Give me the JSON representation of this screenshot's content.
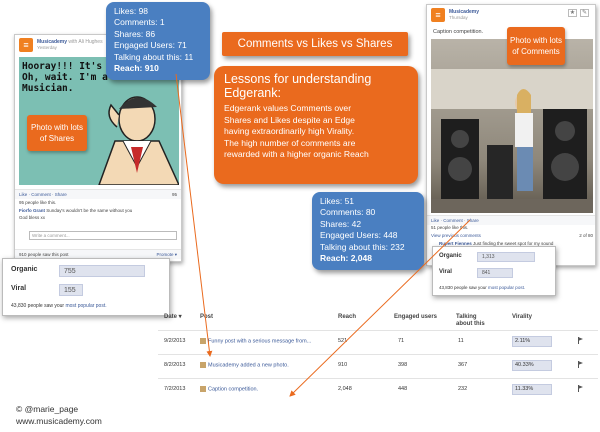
{
  "title_banner": "Comments vs Likes vs Shares",
  "lessons": {
    "heading_line1": "Lessons for understanding",
    "heading_line2": "Edgerank:",
    "body_lines": [
      "Edgerank values Comments over",
      "Shares  and Likes despite an Edge",
      "having extraordinarily  high Virality.",
      "The high number of comments are",
      "rewarded with a higher organic Reach"
    ]
  },
  "stats_left": {
    "lines": [
      "Likes: 98",
      "Comments: 1",
      "Shares: 86",
      "Engaged Users: 71",
      "Talking about this: 11"
    ],
    "reach": "Reach: 910"
  },
  "stats_right": {
    "lines": [
      "Likes: 51",
      "Comments: 80",
      "Shares: 42",
      "Engaged Users: 448",
      "Talking about this: 232"
    ],
    "reach": "Reach: 2,048"
  },
  "left_post": {
    "page_name": "Musicademy",
    "with_text": "with Ali Hughes",
    "time": "Yesterday",
    "meme_lines": [
      "Hooray!!! It's Friday!",
      "Oh, wait.  I'm a",
      "Musician."
    ],
    "callout": "Photo with lots of Shares",
    "actions": "Like · Comment · Share",
    "like_count": "95",
    "likes_text": "95 people like this.",
    "commenter": "Fiorfo Grant",
    "comment": "Sunday's wouldn't be the same without you",
    "comment2": "God bless xx",
    "write_comment": "Write a comment...",
    "seen": "910 people saw this post",
    "promote": "Promote ▾"
  },
  "left_insights": {
    "organic_label": "Organic",
    "organic_value": "755",
    "viral_label": "Viral",
    "viral_value": "155",
    "footer_prefix": "43,830 people saw your ",
    "footer_link": "most popular post."
  },
  "right_post": {
    "page_name": "Musicademy",
    "time": "Thursday",
    "caption": "Caption competition.",
    "callout": "Photo with lots of Comments",
    "actions": "Like · Comment · Share",
    "likes_text": "51 people like this.",
    "view_prev": "View previous comments",
    "page_count": "2 of 80",
    "commenter": "Rupert Fiennes",
    "comment": "Just finding the sweet spot for my sound",
    "comment_tail": "kitchen"
  },
  "right_insights": {
    "organic_label": "Organic",
    "organic_value": "1,313",
    "viral_label": "Viral",
    "viral_value": "841",
    "footer_prefix": "43,830 people saw your ",
    "footer_link": "most popular post."
  },
  "table": {
    "headers": [
      "Date ▾",
      "Post",
      "Reach",
      "Engaged users",
      "Talking about this",
      "Virality"
    ],
    "rows": [
      {
        "date": "9/2/2013",
        "post": "Funny post with a serious message from...",
        "reach": "521",
        "engaged": "71",
        "talking": "11",
        "virality": "2.11%"
      },
      {
        "date": "8/2/2013",
        "post": "Musicademy added a new photo.",
        "reach": "910",
        "engaged": "398",
        "talking": "367",
        "virality": "40.33%"
      },
      {
        "date": "7/2/2013",
        "post": "Caption competition.",
        "reach": "2,048",
        "engaged": "448",
        "talking": "232",
        "virality": "11.33%"
      }
    ]
  },
  "credit": {
    "line1": "© @marie_page",
    "line2": "www.musicademy.com"
  },
  "colors": {
    "orange": "#ea6a1e",
    "blue": "#4a7fc1",
    "facebook_blue": "#3b5998"
  }
}
